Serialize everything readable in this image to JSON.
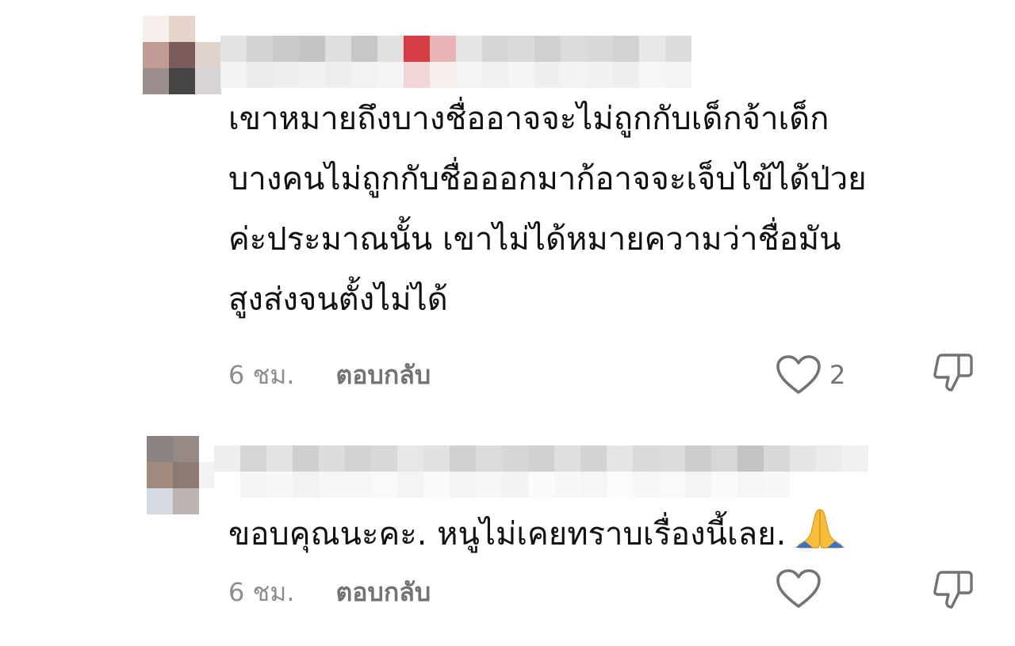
{
  "comments": [
    {
      "username": "",
      "text_lines": [
        "เขาหมายถึงบางชื่ออาจจะไม่ถูกกับเด็กจ้าเด็ก",
        "บางคนไม่ถูกกับชื่อออกมาก้อาจจะเจ็บไข้ได้ป่วย",
        "ค่ะประมาณนั้น เขาไม่ได้หมายความว่าชื่อมัน",
        "สูงส่งจนตั้งไม่ได้"
      ],
      "time": "6 ชม.",
      "reply_label": "ตอบกลับ",
      "like_count": "2",
      "like_icon": "heart-outline-icon",
      "dislike_icon": "thumbs-down-outline-icon"
    },
    {
      "username": "",
      "text": "ขอบคุณนะคะ. หนูไม่เคยทราบเรื่องนี้เลย.",
      "emoji": "folded-hands-emoji",
      "time": "6 ชม.",
      "reply_label": "ตอบกลับ",
      "like_count": "",
      "like_icon": "heart-outline-icon",
      "dislike_icon": "thumbs-down-outline-icon"
    }
  ],
  "colors": {
    "text": "#111111",
    "meta": "#8e8e8e",
    "reply": "#737373",
    "icon": "#737373"
  }
}
